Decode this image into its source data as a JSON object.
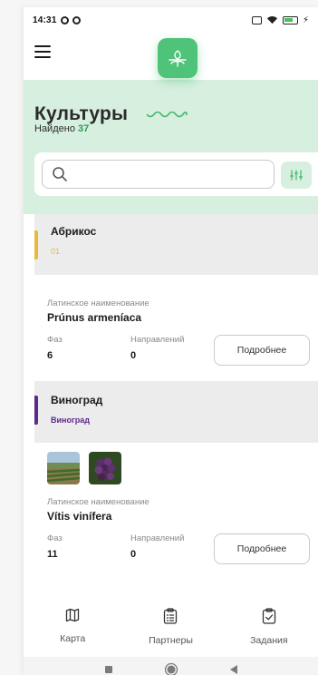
{
  "status_bar": {
    "time": "14:31"
  },
  "header": {
    "title": "Культуры",
    "found_label": "Найдено",
    "found_count": "37"
  },
  "search": {
    "value": "",
    "placeholder": ""
  },
  "items": [
    {
      "name": "Абрикос",
      "subtitle": "01",
      "accent_color": "#e8b93a",
      "latin_label": "Латинское наименование",
      "latin_name": "Prúnus armeníaca",
      "phases_label": "Фаз",
      "phases": "6",
      "directions_label": "Направлений",
      "directions": "0",
      "details_label": "Подробнее"
    },
    {
      "name": "Виноград",
      "subtitle": "Виноград",
      "accent_color": "#5c2a8c",
      "latin_label": "Латинское наименование",
      "latin_name": "Vítis vinífera",
      "phases_label": "Фаз",
      "phases": "11",
      "directions_label": "Направлений",
      "directions": "0",
      "details_label": "Подробнее",
      "images": [
        "vineyard-photo",
        "grapes-photo"
      ]
    }
  ],
  "bottom_nav": [
    {
      "label": "Карта",
      "icon": "map-icon"
    },
    {
      "label": "Партнеры",
      "icon": "clipboard-list-icon"
    },
    {
      "label": "Задания",
      "icon": "clipboard-check-icon"
    }
  ],
  "colors": {
    "brand": "#4fc37a",
    "hero_bg": "#d7efdf",
    "count": "#2f9a55"
  }
}
